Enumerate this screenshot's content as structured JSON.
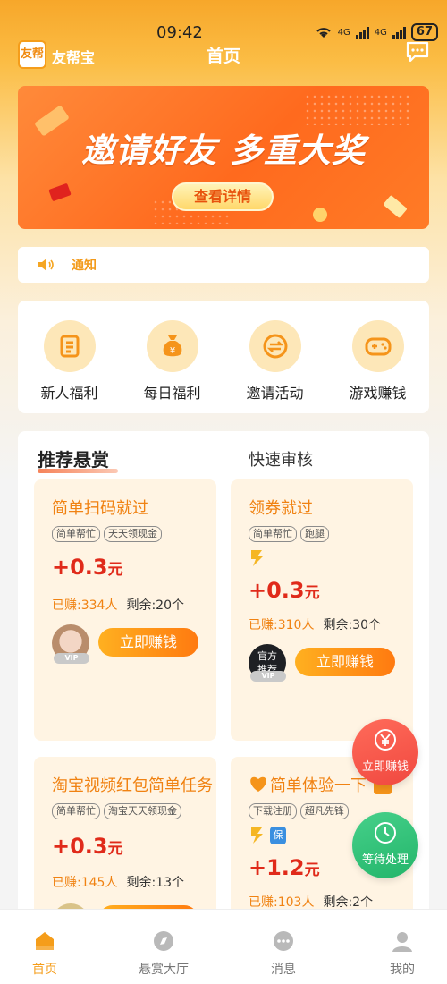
{
  "status_bar": {
    "time": "09:42",
    "network1": "4G",
    "network2": "4G",
    "battery": "67"
  },
  "header": {
    "app_name": "友帮宝",
    "logo_text": "友帮",
    "title": "首页"
  },
  "banner": {
    "headline": "邀请好友 多重大奖",
    "button_label": "查看详情"
  },
  "notice": {
    "label": "通知"
  },
  "menu": [
    {
      "label": "新人福利",
      "icon": "newcomer-icon"
    },
    {
      "label": "每日福利",
      "icon": "money-bag-icon"
    },
    {
      "label": "邀请活动",
      "icon": "invite-icon"
    },
    {
      "label": "游戏赚钱",
      "icon": "gamepad-icon"
    }
  ],
  "rewards": {
    "tab_recommended": "推荐悬赏",
    "tab_quick_review": "快速审核",
    "cards": [
      {
        "title": "简单扫码就过",
        "tags": [
          "简单帮忙",
          "天天领现金"
        ],
        "price": "+0.3",
        "unit": "元",
        "earned": "已赚:334人",
        "remaining": "剩余:20个",
        "button": "立即赚钱",
        "vip": "VIP"
      },
      {
        "title": "领券就过",
        "tags": [
          "简单帮忙",
          "跑腿"
        ],
        "price": "+0.3",
        "unit": "元",
        "earned": "已赚:310人",
        "remaining": "剩余:30个",
        "button": "立即赚钱",
        "vip": "VIP",
        "avatar_text": [
          "官方",
          "推荐"
        ]
      },
      {
        "title": "淘宝视频红包简单任务",
        "tags": [
          "简单帮忙",
          "淘宝天天领现金"
        ],
        "price": "+0.3",
        "unit": "元",
        "earned": "已赚:145人",
        "remaining": "剩余:13个"
      },
      {
        "title": "简单体验一下",
        "tags": [
          "下载注册",
          "超凡先锋"
        ],
        "price": "+1.2",
        "unit": "元",
        "earned": "已赚:103人",
        "remaining": "剩余:2个",
        "badge": "保"
      }
    ]
  },
  "floating": {
    "earn": "立即赚钱",
    "pending": "等待处理"
  },
  "bottom_nav": [
    {
      "label": "首页",
      "icon": "home-icon",
      "active": true
    },
    {
      "label": "悬赏大厅",
      "icon": "hall-icon"
    },
    {
      "label": "消息",
      "icon": "message-icon"
    },
    {
      "label": "我的",
      "icon": "profile-icon"
    }
  ],
  "colors": {
    "primary": "#f59d1a",
    "price": "#e02a1a",
    "card_bg": "#fff4e3"
  }
}
